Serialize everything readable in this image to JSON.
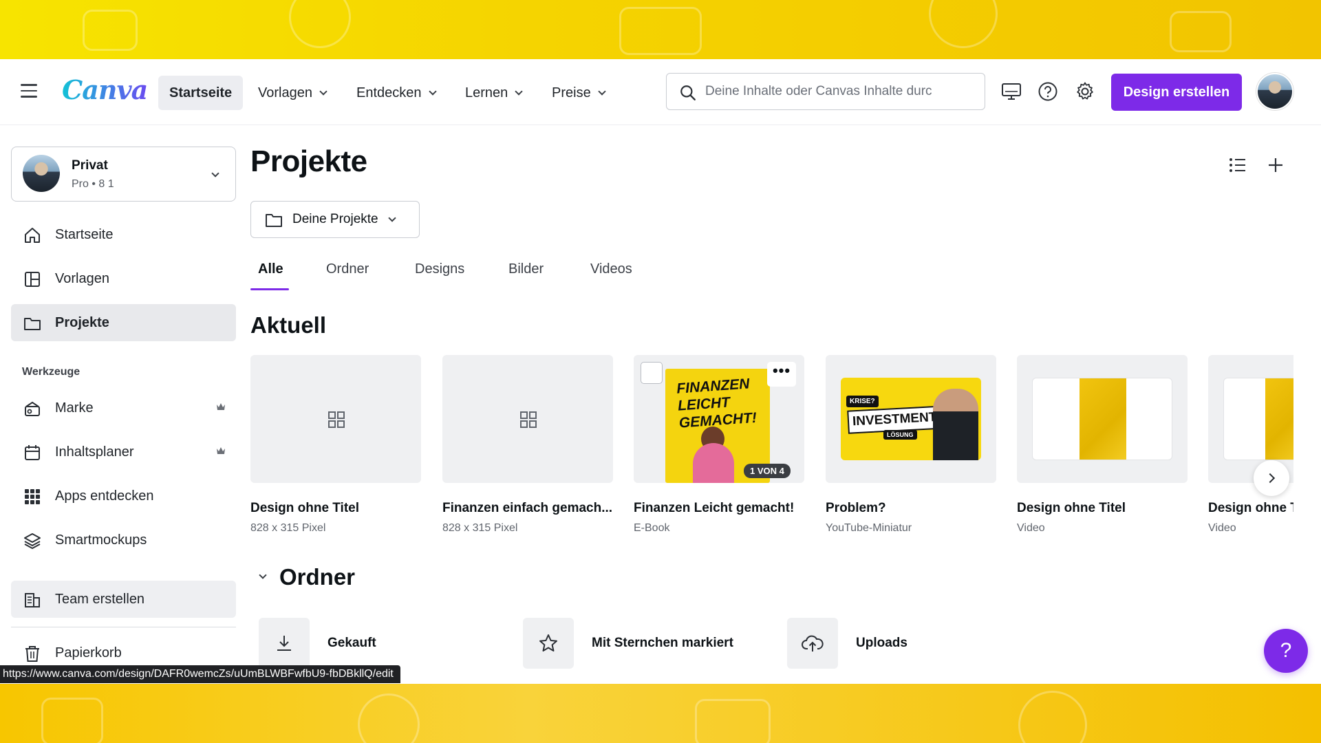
{
  "nav": {
    "logo": "Canva",
    "items": [
      {
        "label": "Startseite"
      },
      {
        "label": "Vorlagen"
      },
      {
        "label": "Entdecken"
      },
      {
        "label": "Lernen"
      },
      {
        "label": "Preise"
      }
    ],
    "search_placeholder": "Deine Inhalte oder Canvas Inhalte durc",
    "create_button": "Design erstellen"
  },
  "account": {
    "name": "Privat",
    "plan": "Pro • 8 1"
  },
  "sidebar": {
    "items": [
      {
        "label": "Startseite",
        "icon": "home-icon"
      },
      {
        "label": "Vorlagen",
        "icon": "template-icon"
      },
      {
        "label": "Projekte",
        "icon": "folder-icon"
      }
    ],
    "tools_heading": "Werkzeuge",
    "tools": [
      {
        "label": "Marke",
        "icon": "brand-icon",
        "premium": true
      },
      {
        "label": "Inhaltsplaner",
        "icon": "calendar-icon",
        "premium": true
      },
      {
        "label": "Apps entdecken",
        "icon": "apps-grid-icon",
        "premium": false
      },
      {
        "label": "Smartmockups",
        "icon": "layers-icon",
        "premium": false
      }
    ],
    "team": "Team erstellen",
    "trash": "Papierkorb"
  },
  "main": {
    "title": "Projekte",
    "folder_dropdown": "Deine Projekte",
    "tabs": [
      "Alle",
      "Ordner",
      "Designs",
      "Bilder",
      "Videos"
    ],
    "active_tab": "Alle",
    "recent_heading": "Aktuell",
    "designs": [
      {
        "title": "Design ohne Titel",
        "meta": "828 x 315 Pixel"
      },
      {
        "title": "Finanzen einfach gemach...",
        "meta": "828 x 315 Pixel"
      },
      {
        "title": "Finanzen Leicht gemacht!",
        "meta": "E-Book",
        "cover_title": "FINANZEN LEICHT GEMACHT!",
        "badge": "1 VON 4",
        "more": "•••"
      },
      {
        "title": "Problem?",
        "meta": "YouTube-Miniatur",
        "thumb_texts": {
          "krise": "KRISE?",
          "investment": "INVESTMENT!",
          "loesung": "LÖSUNG"
        }
      },
      {
        "title": "Design ohne Titel",
        "meta": "Video"
      },
      {
        "title": "Design ohne T",
        "meta": "Video"
      }
    ],
    "folders_heading": "Ordner",
    "folders": [
      {
        "label": "Gekauft",
        "icon": "download-icon"
      },
      {
        "label": "Mit Sternchen markiert",
        "icon": "star-icon"
      },
      {
        "label": "Uploads",
        "icon": "cloud-upload-icon"
      }
    ]
  },
  "help_fab": "?",
  "status_url": "https://www.canva.com/design/DAFR0wemcZs/uUmBLWBFwfbU9-fbDBkllQ/edit",
  "colors": {
    "accent": "#7d2ae8",
    "banner": "#f5d000"
  }
}
